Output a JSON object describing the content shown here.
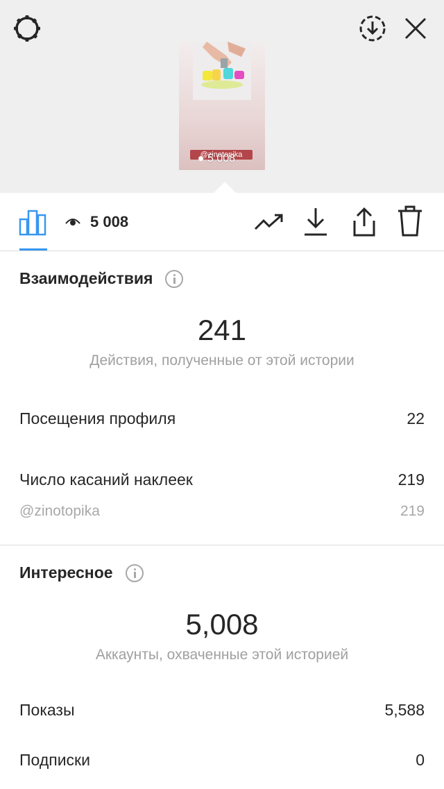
{
  "top_bar": {
    "settings_icon": "settings-gear-icon",
    "save_icon": "download-circle-icon",
    "close_icon": "close-icon"
  },
  "story_preview": {
    "tag": "@zinotopika",
    "views": "5 008"
  },
  "toolbar": {
    "views_count": "5 008",
    "active_tab_color": "#3897f0",
    "icons": [
      "bar-chart-icon",
      "eye-icon",
      "trend-icon",
      "download-icon",
      "share-icon",
      "trash-icon"
    ]
  },
  "interactions": {
    "title": "Взаимодействия",
    "total": "241",
    "caption": "Действия, полученные от этой истории",
    "rows": [
      {
        "label": "Посещения профиля",
        "value": "22"
      },
      {
        "label": "Число касаний наклеек",
        "value": "219"
      }
    ],
    "sub_row": {
      "label": "@zinotopika",
      "value": "219"
    }
  },
  "discovery": {
    "title": "Интересное",
    "total": "5,008",
    "caption": "Аккаунты, охваченные этой историей",
    "rows": [
      {
        "label": "Показы",
        "value": "5,588"
      },
      {
        "label": "Подписки",
        "value": "0"
      }
    ]
  }
}
